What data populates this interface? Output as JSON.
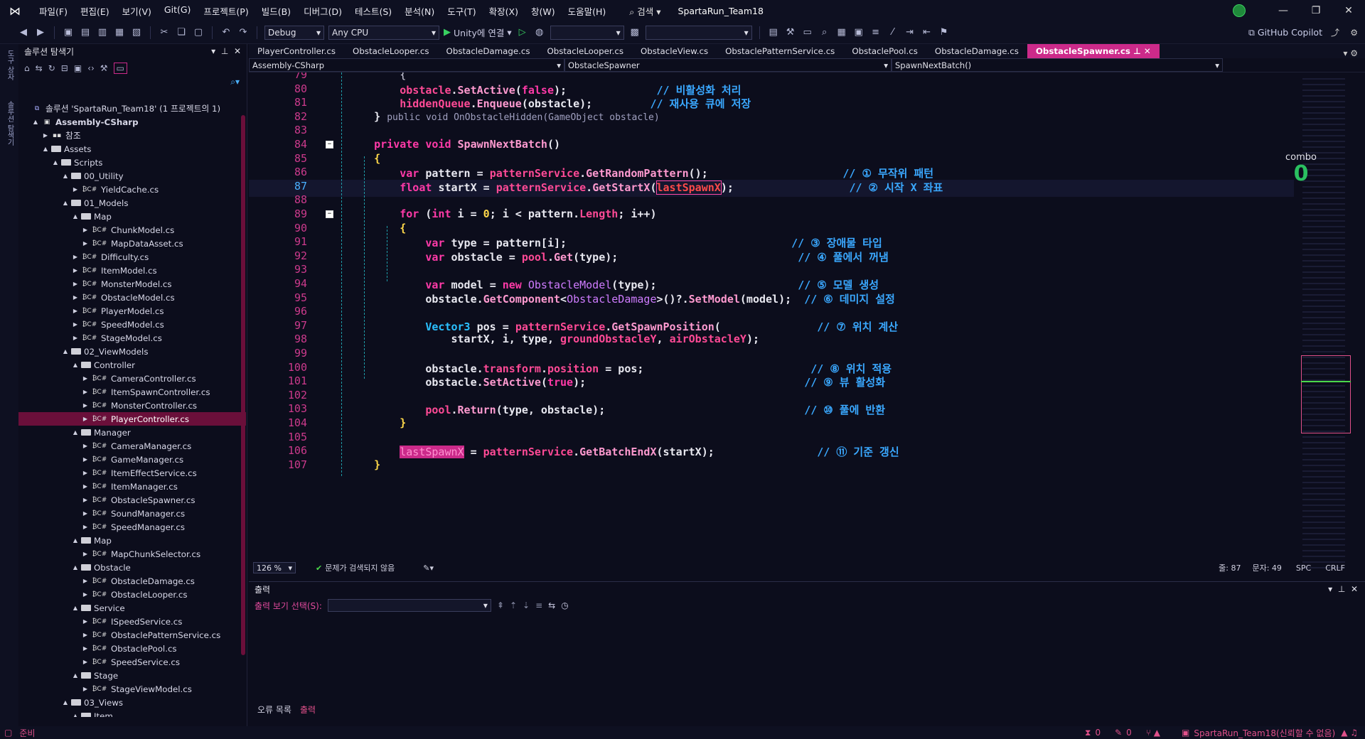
{
  "menubar": {
    "items": [
      "파일(F)",
      "편집(E)",
      "보기(V)",
      "Git(G)",
      "프로젝트(P)",
      "빌드(B)",
      "디버그(D)",
      "테스트(S)",
      "분석(N)",
      "도구(T)",
      "확장(X)",
      "창(W)",
      "도움말(H)"
    ],
    "search_label": "검색",
    "solution_name": "SpartaRun_Team18"
  },
  "toolbar": {
    "config": "Debug",
    "platform": "Any CPU",
    "run_label": "Unity에 연결",
    "copilot_label": "GitHub Copilot"
  },
  "left_rail": {
    "tabs": [
      "도구 상자",
      "솔루션 탐색기"
    ]
  },
  "solution_explorer": {
    "title": "솔루션 탐색기",
    "rows": [
      {
        "indent": 0,
        "expander": "",
        "icon": "sol",
        "label": "솔루션 'SpartaRun_Team18' (1 프로젝트의 1)",
        "selected": false
      },
      {
        "indent": 1,
        "expander": "▲",
        "icon": "proj",
        "label": "Assembly-CSharp",
        "selected": false,
        "bold": true
      },
      {
        "indent": 2,
        "expander": "▶",
        "icon": "ref",
        "label": "참조",
        "selected": false
      },
      {
        "indent": 2,
        "expander": "▲",
        "icon": "folder",
        "label": "Assets",
        "selected": false
      },
      {
        "indent": 3,
        "expander": "▲",
        "icon": "folder",
        "label": "Scripts",
        "selected": false
      },
      {
        "indent": 4,
        "expander": "▲",
        "icon": "folder",
        "label": "00_Utility",
        "selected": false
      },
      {
        "indent": 5,
        "expander": "▶",
        "icon": "cs",
        "label": "YieldCache.cs",
        "selected": false
      },
      {
        "indent": 4,
        "expander": "▲",
        "icon": "folder",
        "label": "01_Models",
        "selected": false
      },
      {
        "indent": 5,
        "expander": "▲",
        "icon": "folder",
        "label": "Map",
        "selected": false
      },
      {
        "indent": 6,
        "expander": "▶",
        "icon": "cs",
        "label": "ChunkModel.cs",
        "selected": false
      },
      {
        "indent": 6,
        "expander": "▶",
        "icon": "cs",
        "label": "MapDataAsset.cs",
        "selected": false
      },
      {
        "indent": 5,
        "expander": "▶",
        "icon": "cs",
        "label": "Difficulty.cs",
        "selected": false
      },
      {
        "indent": 5,
        "expander": "▶",
        "icon": "cs",
        "label": "ItemModel.cs",
        "selected": false
      },
      {
        "indent": 5,
        "expander": "▶",
        "icon": "cs",
        "label": "MonsterModel.cs",
        "selected": false
      },
      {
        "indent": 5,
        "expander": "▶",
        "icon": "cs",
        "label": "ObstacleModel.cs",
        "selected": false
      },
      {
        "indent": 5,
        "expander": "▶",
        "icon": "cs",
        "label": "PlayerModel.cs",
        "selected": false
      },
      {
        "indent": 5,
        "expander": "▶",
        "icon": "cs",
        "label": "SpeedModel.cs",
        "selected": false
      },
      {
        "indent": 5,
        "expander": "▶",
        "icon": "cs",
        "label": "StageModel.cs",
        "selected": false
      },
      {
        "indent": 4,
        "expander": "▲",
        "icon": "folder",
        "label": "02_ViewModels",
        "selected": false
      },
      {
        "indent": 5,
        "expander": "▲",
        "icon": "folder",
        "label": "Controller",
        "selected": false
      },
      {
        "indent": 6,
        "expander": "▶",
        "icon": "cs",
        "label": "CameraController.cs",
        "selected": false
      },
      {
        "indent": 6,
        "expander": "▶",
        "icon": "cs",
        "label": "ItemSpawnController.cs",
        "selected": false
      },
      {
        "indent": 6,
        "expander": "▶",
        "icon": "cs",
        "label": "MonsterController.cs",
        "selected": false
      },
      {
        "indent": 6,
        "expander": "▶",
        "icon": "cs",
        "label": "PlayerController.cs",
        "selected": true
      },
      {
        "indent": 5,
        "expander": "▲",
        "icon": "folder",
        "label": "Manager",
        "selected": false
      },
      {
        "indent": 6,
        "expander": "▶",
        "icon": "cs",
        "label": "CameraManager.cs",
        "selected": false
      },
      {
        "indent": 6,
        "expander": "▶",
        "icon": "cs",
        "label": "GameManager.cs",
        "selected": false
      },
      {
        "indent": 6,
        "expander": "▶",
        "icon": "cs",
        "label": "ItemEffectService.cs",
        "selected": false
      },
      {
        "indent": 6,
        "expander": "▶",
        "icon": "cs",
        "label": "ItemManager.cs",
        "selected": false
      },
      {
        "indent": 6,
        "expander": "▶",
        "icon": "cs",
        "label": "ObstacleSpawner.cs",
        "selected": false
      },
      {
        "indent": 6,
        "expander": "▶",
        "icon": "cs",
        "label": "SoundManager.cs",
        "selected": false
      },
      {
        "indent": 6,
        "expander": "▶",
        "icon": "cs",
        "label": "SpeedManager.cs",
        "selected": false
      },
      {
        "indent": 5,
        "expander": "▲",
        "icon": "folder",
        "label": "Map",
        "selected": false
      },
      {
        "indent": 6,
        "expander": "▶",
        "icon": "cs",
        "label": "MapChunkSelector.cs",
        "selected": false
      },
      {
        "indent": 5,
        "expander": "▲",
        "icon": "folder",
        "label": "Obstacle",
        "selected": false
      },
      {
        "indent": 6,
        "expander": "▶",
        "icon": "cs",
        "label": "ObstacleDamage.cs",
        "selected": false
      },
      {
        "indent": 6,
        "expander": "▶",
        "icon": "cs",
        "label": "ObstacleLooper.cs",
        "selected": false
      },
      {
        "indent": 5,
        "expander": "▲",
        "icon": "folder",
        "label": "Service",
        "selected": false
      },
      {
        "indent": 6,
        "expander": "▶",
        "icon": "cs",
        "label": "ISpeedService.cs",
        "selected": false
      },
      {
        "indent": 6,
        "expander": "▶",
        "icon": "cs",
        "label": "ObstaclePatternService.cs",
        "selected": false
      },
      {
        "indent": 6,
        "expander": "▶",
        "icon": "cs",
        "label": "ObstaclePool.cs",
        "selected": false
      },
      {
        "indent": 6,
        "expander": "▶",
        "icon": "cs",
        "label": "SpeedService.cs",
        "selected": false
      },
      {
        "indent": 5,
        "expander": "▲",
        "icon": "folder",
        "label": "Stage",
        "selected": false
      },
      {
        "indent": 6,
        "expander": "▶",
        "icon": "cs",
        "label": "StageViewModel.cs",
        "selected": false
      },
      {
        "indent": 4,
        "expander": "▲",
        "icon": "folder",
        "label": "03_Views",
        "selected": false
      },
      {
        "indent": 5,
        "expander": "▲",
        "icon": "folder",
        "label": "Item",
        "selected": false
      }
    ]
  },
  "editor": {
    "tabs": [
      {
        "label": "PlayerController.cs",
        "active": false
      },
      {
        "label": "ObstacleLooper.cs",
        "active": false
      },
      {
        "label": "ObstacleDamage.cs",
        "active": false
      },
      {
        "label": "ObstacleLooper.cs",
        "active": false
      },
      {
        "label": "ObstacleView.cs",
        "active": false
      },
      {
        "label": "ObstaclePatternService.cs",
        "active": false
      },
      {
        "label": "ObstaclePool.cs",
        "active": false
      },
      {
        "label": "ObstacleDamage.cs",
        "active": false
      },
      {
        "label": "ObstacleSpawner.cs",
        "active": true
      }
    ],
    "nav": {
      "project": "Assembly-CSharp",
      "class": "ObstacleSpawner",
      "member": "SpawnNextBatch()"
    },
    "current_line": 87,
    "hud_label": "combo",
    "hud_value": "0",
    "lines": [
      {
        "n": "79",
        "html": "        {",
        "cur": false
      },
      {
        "n": "80",
        "html": "        <span class='m'>obstacle</span><span class='p'>.</span><span class='f'>SetActive</span><span class='p'>(</span><span class='k'>false</span><span class='p'>);</span>              <span class='c'>// 비활성화 처리</span>",
        "cur": false
      },
      {
        "n": "81",
        "html": "        <span class='m'>hiddenQueue</span><span class='p'>.</span><span class='f'>Enqueue</span><span class='p'>(obstacle);</span>         <span class='c'>// 재사용 큐에 저장</span>",
        "cur": false
      },
      {
        "n": "82",
        "html": "    <span class='p'>}</span> <span class='ghost'>public void OnObstacleHidden(GameObject obstacle)</span>",
        "cur": false
      },
      {
        "n": "83",
        "html": "",
        "cur": false
      },
      {
        "n": "84",
        "html": "    <span class='k'>private</span> <span class='k'>void</span> <span class='f'>SpawnNextBatch</span><span class='p'>()</span>",
        "cur": false
      },
      {
        "n": "85",
        "html": "    <span class='v'>{</span>",
        "cur": false
      },
      {
        "n": "86",
        "html": "        <span class='k'>var</span> <span class='p'>pattern</span> <span class='p'>=</span> <span class='m'>patternService</span><span class='p'>.</span><span class='f'>GetRandomPattern</span><span class='p'>();</span>                     <span class='c'>// ① 무작위 패턴</span>",
        "cur": false
      },
      {
        "n": "87",
        "html": "        <span class='k'>float</span> <span class='p'>startX</span> <span class='p'>=</span> <span class='m'>patternService</span><span class='p'>.</span><span class='f'>GetStartX</span><span class='p'>(</span><span class='nm hl'>lastSpawnX</span><span class='p'>);</span>                  <span class='c'>// ② 시작 X 좌표</span>",
        "cur": true
      },
      {
        "n": "88",
        "html": "",
        "cur": false
      },
      {
        "n": "89",
        "html": "        <span class='k'>for</span> <span class='p'>(</span><span class='k'>int</span> <span class='p'>i</span> <span class='p'>=</span> <span class='v'>0</span><span class='p'>; i &lt; pattern.</span><span class='m'>Length</span><span class='p'>; i++)</span>",
        "cur": false
      },
      {
        "n": "90",
        "html": "        <span class='v'>{</span>",
        "cur": false
      },
      {
        "n": "91",
        "html": "            <span class='k'>var</span> <span class='p'>type</span> <span class='p'>= pattern[i];</span>                                   <span class='c'>// ③ 장애물 타입</span>",
        "cur": false
      },
      {
        "n": "92",
        "html": "            <span class='k'>var</span> <span class='p'>obstacle</span> <span class='p'>=</span> <span class='m'>pool</span><span class='p'>.</span><span class='f'>Get</span><span class='p'>(type);</span>                            <span class='c'>// ④ 풀에서 꺼냄</span>",
        "cur": false
      },
      {
        "n": "93",
        "html": "",
        "cur": false
      },
      {
        "n": "94",
        "html": "            <span class='k'>var</span> <span class='p'>model</span> <span class='p'>=</span> <span class='k'>new</span> <span class='t'>ObstacleModel</span><span class='p'>(type);</span>                      <span class='c'>// ⑤ 모델 생성</span>",
        "cur": false
      },
      {
        "n": "95",
        "html": "            <span class='p'>obstacle.</span><span class='f'>GetComponent</span><span class='p'>&lt;</span><span class='t'>ObstacleDamage</span><span class='p'>&gt;()?.</span><span class='f'>SetModel</span><span class='p'>(model);</span>  <span class='c'>// ⑥ 데미지 설정</span>",
        "cur": false
      },
      {
        "n": "96",
        "html": "",
        "cur": false
      },
      {
        "n": "97",
        "html": "            <span class='ty'>Vector3</span> <span class='p'>pos</span> <span class='p'>=</span> <span class='m'>patternService</span><span class='p'>.</span><span class='f'>GetSpawnPosition</span><span class='p'>(</span>               <span class='c'>// ⑦ 위치 계산</span>",
        "cur": false
      },
      {
        "n": "98",
        "html": "                <span class='p'>startX, i, type,</span> <span class='m'>groundObstacleY</span><span class='p'>,</span> <span class='m'>airObstacleY</span><span class='p'>);</span>",
        "cur": false
      },
      {
        "n": "99",
        "html": "",
        "cur": false
      },
      {
        "n": "100",
        "html": "            <span class='p'>obstacle.</span><span class='m'>transform</span><span class='p'>.</span><span class='m'>position</span> <span class='p'>= pos;</span>                          <span class='c'>// ⑧ 위치 적용</span>",
        "cur": false
      },
      {
        "n": "101",
        "html": "            <span class='p'>obstacle.</span><span class='f'>SetActive</span><span class='p'>(</span><span class='k'>true</span><span class='p'>);</span>                                  <span class='c'>// ⑨ 뷰 활성화</span>",
        "cur": false
      },
      {
        "n": "102",
        "html": "",
        "cur": false
      },
      {
        "n": "103",
        "html": "            <span class='m'>pool</span><span class='p'>.</span><span class='f'>Return</span><span class='p'>(type, obstacle);</span>                               <span class='c'>// ⑩ 풀에 반환</span>",
        "cur": false
      },
      {
        "n": "104",
        "html": "        <span class='v'>}</span>",
        "cur": false
      },
      {
        "n": "105",
        "html": "",
        "cur": false
      },
      {
        "n": "106",
        "html": "        <span class='hl2'>lastSpawnX</span> <span class='p'>=</span> <span class='m'>patternService</span><span class='p'>.</span><span class='f'>GetBatchEndX</span><span class='p'>(startX);</span>                <span class='c'>// ⑪ 기준 갱신</span>",
        "cur": false
      },
      {
        "n": "107",
        "html": "    <span class='v'>}</span>",
        "cur": false
      }
    ]
  },
  "editor_status": {
    "zoom": "126 %",
    "issues": "문제가 검색되지 않음",
    "line": "줄: 87",
    "col": "문자: 49",
    "spc": "SPC",
    "eol": "CRLF"
  },
  "output": {
    "title": "출력",
    "show_label": "출력 보기 선택(S):"
  },
  "bottom_tabs": [
    "오류 목록",
    "출력"
  ],
  "statusbar": {
    "ready": "준비",
    "errors": "0",
    "warnings": "0",
    "repo": "SpartaRun_Team18(신뢰할 수 없음)"
  }
}
